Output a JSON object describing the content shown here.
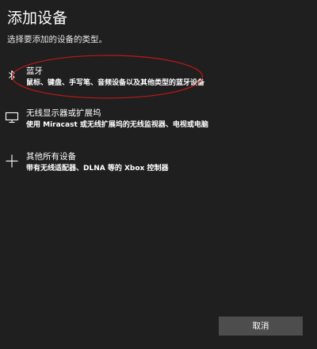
{
  "dialog": {
    "title": "添加设备",
    "subtitle": "选择要添加的设备的类型。"
  },
  "options": [
    {
      "icon": "bluetooth-icon",
      "name": "蓝牙",
      "description": "鼠标、键盘、手写笔、音频设备以及其他类型的蓝牙设备"
    },
    {
      "icon": "monitor-icon",
      "name": "无线显示器或扩展坞",
      "description": "使用 Miracast 或无线扩展坞的无线监视器、电视或电脑"
    },
    {
      "icon": "plus-icon",
      "name": "其他所有设备",
      "description": "带有无线适配器、DLNA 等的 Xbox 控制器"
    }
  ],
  "actions": {
    "cancel_label": "取消"
  },
  "colors": {
    "background": "#1f1f1f",
    "text": "#ffffff",
    "button_background": "#4d4d4d",
    "annotation": "#c01818"
  }
}
